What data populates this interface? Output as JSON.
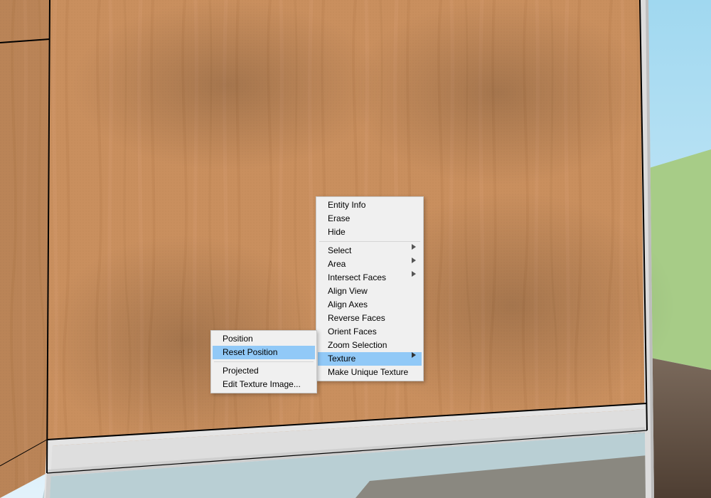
{
  "context_menu": {
    "items": [
      {
        "label": "Entity Info",
        "submenu": false
      },
      {
        "label": "Erase",
        "submenu": false
      },
      {
        "label": "Hide",
        "submenu": false
      },
      {
        "sep": true
      },
      {
        "label": "Select",
        "submenu": true
      },
      {
        "label": "Area",
        "submenu": true
      },
      {
        "label": "Intersect Faces",
        "submenu": true
      },
      {
        "label": "Align View",
        "submenu": false
      },
      {
        "label": "Align Axes",
        "submenu": false
      },
      {
        "label": "Reverse Faces",
        "submenu": false
      },
      {
        "label": "Orient Faces",
        "submenu": false
      },
      {
        "label": "Zoom Selection",
        "submenu": false
      },
      {
        "label": "Texture",
        "submenu": true,
        "highlighted": true
      },
      {
        "label": "Make Unique Texture",
        "submenu": false
      }
    ]
  },
  "texture_submenu": {
    "items": [
      {
        "label": "Position",
        "submenu": false
      },
      {
        "label": "Reset Position",
        "submenu": false,
        "highlighted": true
      },
      {
        "sep": true
      },
      {
        "label": "Projected",
        "submenu": false
      },
      {
        "label": "Edit Texture Image...",
        "submenu": false
      }
    ]
  },
  "scene": {
    "sky_top": "#a0d8f0",
    "sky_bottom": "#e2f2fb",
    "grass": "#9bc07b",
    "floor_near": "#5e4b3d",
    "floor_far": "#7b6a5c",
    "glass": "#b9cfd4",
    "frame": "#e4e4e4",
    "wood_base": "#c98f5e",
    "wood_light": "#d7a176",
    "wood_dark": "#b87e4e",
    "edge": "#000000"
  }
}
